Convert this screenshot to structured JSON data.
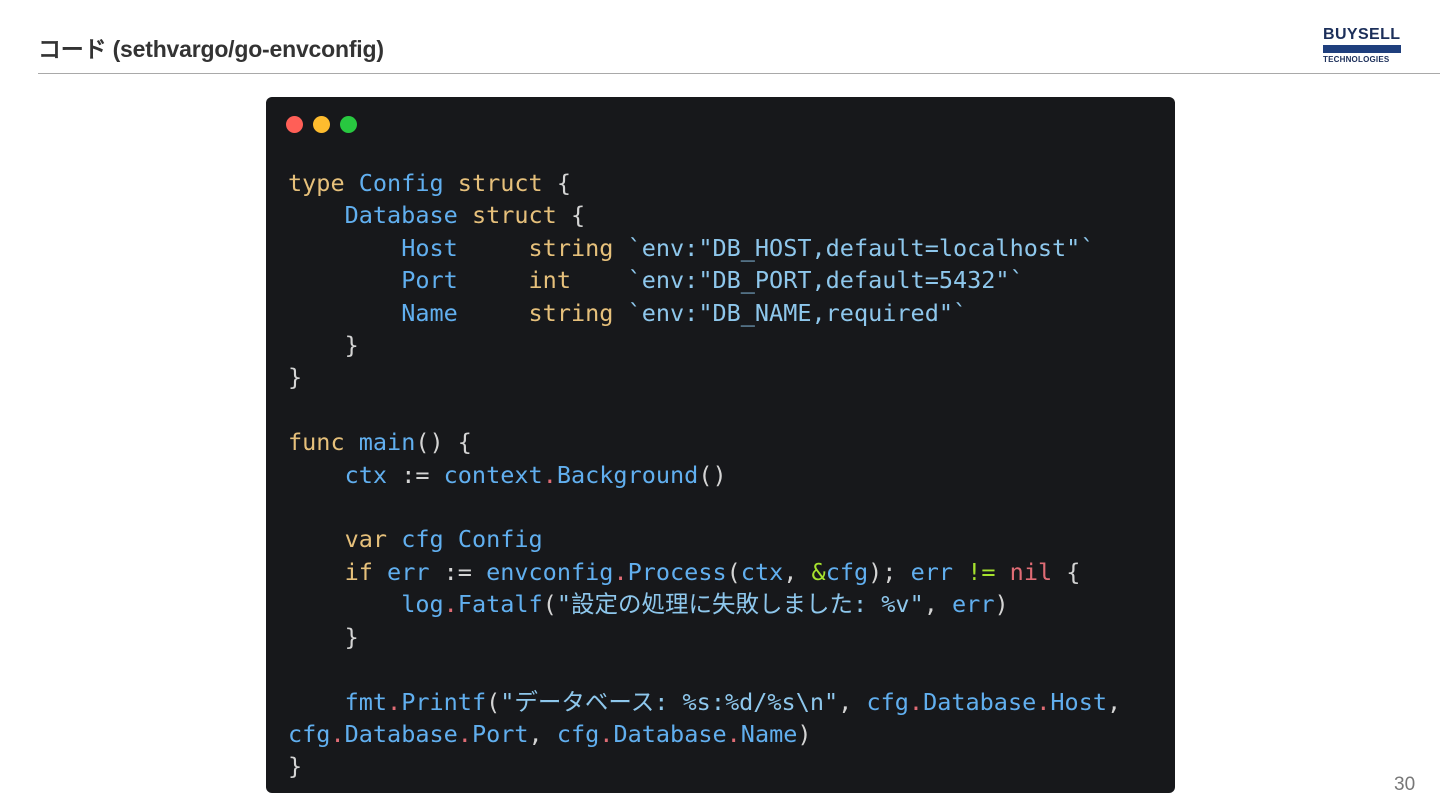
{
  "slide": {
    "title": "コード (sethvargo/go-envconfig)",
    "page_number": "30"
  },
  "logo": {
    "top_text": "BUYSELL",
    "bottom_text": "TECHNOLOGIES",
    "color": "#1c2f5a",
    "bar_color": "#1f3f7d"
  },
  "code_window": {
    "background": "#17181b",
    "traffic_lights": [
      "#ff5f57",
      "#febc2e",
      "#28c840"
    ],
    "lines": [
      [
        {
          "t": "type",
          "c": "kw"
        },
        {
          "t": " ",
          "c": "pn"
        },
        {
          "t": "Config",
          "c": "id"
        },
        {
          "t": " ",
          "c": "pn"
        },
        {
          "t": "struct",
          "c": "kw"
        },
        {
          "t": " {",
          "c": "pn"
        }
      ],
      [
        {
          "t": "    ",
          "c": "pn"
        },
        {
          "t": "Database",
          "c": "id"
        },
        {
          "t": " ",
          "c": "pn"
        },
        {
          "t": "struct",
          "c": "kw"
        },
        {
          "t": " {",
          "c": "pn"
        }
      ],
      [
        {
          "t": "        ",
          "c": "pn"
        },
        {
          "t": "Host",
          "c": "id"
        },
        {
          "t": "     ",
          "c": "pn"
        },
        {
          "t": "string",
          "c": "kw"
        },
        {
          "t": " ",
          "c": "pn"
        },
        {
          "t": "`env:\"DB_HOST,default=localhost\"`",
          "c": "st"
        }
      ],
      [
        {
          "t": "        ",
          "c": "pn"
        },
        {
          "t": "Port",
          "c": "id"
        },
        {
          "t": "     ",
          "c": "pn"
        },
        {
          "t": "int",
          "c": "kw"
        },
        {
          "t": "    ",
          "c": "pn"
        },
        {
          "t": "`env:\"DB_PORT,default=5432\"`",
          "c": "st"
        }
      ],
      [
        {
          "t": "        ",
          "c": "pn"
        },
        {
          "t": "Name",
          "c": "id"
        },
        {
          "t": "     ",
          "c": "pn"
        },
        {
          "t": "string",
          "c": "kw"
        },
        {
          "t": " ",
          "c": "pn"
        },
        {
          "t": "`env:\"DB_NAME,required\"`",
          "c": "st"
        }
      ],
      [
        {
          "t": "    }",
          "c": "pn"
        }
      ],
      [
        {
          "t": "}",
          "c": "pn"
        }
      ],
      [
        {
          "t": "",
          "c": "pn"
        }
      ],
      [
        {
          "t": "func",
          "c": "kw"
        },
        {
          "t": " ",
          "c": "pn"
        },
        {
          "t": "main",
          "c": "id"
        },
        {
          "t": "() {",
          "c": "pn"
        }
      ],
      [
        {
          "t": "    ",
          "c": "pn"
        },
        {
          "t": "ctx",
          "c": "id"
        },
        {
          "t": " := ",
          "c": "pn"
        },
        {
          "t": "context",
          "c": "id"
        },
        {
          "t": ".",
          "c": "dt"
        },
        {
          "t": "Background",
          "c": "id"
        },
        {
          "t": "()",
          "c": "pn"
        }
      ],
      [
        {
          "t": "",
          "c": "pn"
        }
      ],
      [
        {
          "t": "    ",
          "c": "pn"
        },
        {
          "t": "var",
          "c": "kw"
        },
        {
          "t": " ",
          "c": "pn"
        },
        {
          "t": "cfg",
          "c": "id"
        },
        {
          "t": " ",
          "c": "pn"
        },
        {
          "t": "Config",
          "c": "id"
        }
      ],
      [
        {
          "t": "    ",
          "c": "pn"
        },
        {
          "t": "if",
          "c": "kw"
        },
        {
          "t": " ",
          "c": "pn"
        },
        {
          "t": "err",
          "c": "id"
        },
        {
          "t": " := ",
          "c": "pn"
        },
        {
          "t": "envconfig",
          "c": "id"
        },
        {
          "t": ".",
          "c": "dt"
        },
        {
          "t": "Process",
          "c": "id"
        },
        {
          "t": "(",
          "c": "pn"
        },
        {
          "t": "ctx",
          "c": "id"
        },
        {
          "t": ", ",
          "c": "pn"
        },
        {
          "t": "&",
          "c": "op"
        },
        {
          "t": "cfg",
          "c": "id"
        },
        {
          "t": "); ",
          "c": "pn"
        },
        {
          "t": "err",
          "c": "id"
        },
        {
          "t": " ",
          "c": "pn"
        },
        {
          "t": "!=",
          "c": "op"
        },
        {
          "t": " ",
          "c": "pn"
        },
        {
          "t": "nil",
          "c": "nl"
        },
        {
          "t": " {",
          "c": "pn"
        }
      ],
      [
        {
          "t": "        ",
          "c": "pn"
        },
        {
          "t": "log",
          "c": "id"
        },
        {
          "t": ".",
          "c": "dt"
        },
        {
          "t": "Fatalf",
          "c": "id"
        },
        {
          "t": "(",
          "c": "pn"
        },
        {
          "t": "\"設定の処理に失敗しました: %v\"",
          "c": "st"
        },
        {
          "t": ", ",
          "c": "pn"
        },
        {
          "t": "err",
          "c": "id"
        },
        {
          "t": ")",
          "c": "pn"
        }
      ],
      [
        {
          "t": "    }",
          "c": "pn"
        }
      ],
      [
        {
          "t": "",
          "c": "pn"
        }
      ],
      [
        {
          "t": "    ",
          "c": "pn"
        },
        {
          "t": "fmt",
          "c": "id"
        },
        {
          "t": ".",
          "c": "dt"
        },
        {
          "t": "Printf",
          "c": "id"
        },
        {
          "t": "(",
          "c": "pn"
        },
        {
          "t": "\"データベース: %s:%d/%s\\n\"",
          "c": "st"
        },
        {
          "t": ", ",
          "c": "pn"
        },
        {
          "t": "cfg",
          "c": "id"
        },
        {
          "t": ".",
          "c": "dt"
        },
        {
          "t": "Database",
          "c": "id"
        },
        {
          "t": ".",
          "c": "dt"
        },
        {
          "t": "Host",
          "c": "id"
        },
        {
          "t": ",",
          "c": "pn"
        }
      ],
      [
        {
          "t": "cfg",
          "c": "id"
        },
        {
          "t": ".",
          "c": "dt"
        },
        {
          "t": "Database",
          "c": "id"
        },
        {
          "t": ".",
          "c": "dt"
        },
        {
          "t": "Port",
          "c": "id"
        },
        {
          "t": ", ",
          "c": "pn"
        },
        {
          "t": "cfg",
          "c": "id"
        },
        {
          "t": ".",
          "c": "dt"
        },
        {
          "t": "Database",
          "c": "id"
        },
        {
          "t": ".",
          "c": "dt"
        },
        {
          "t": "Name",
          "c": "id"
        },
        {
          "t": ")",
          "c": "pn"
        }
      ],
      [
        {
          "t": "}",
          "c": "pn"
        }
      ]
    ]
  }
}
